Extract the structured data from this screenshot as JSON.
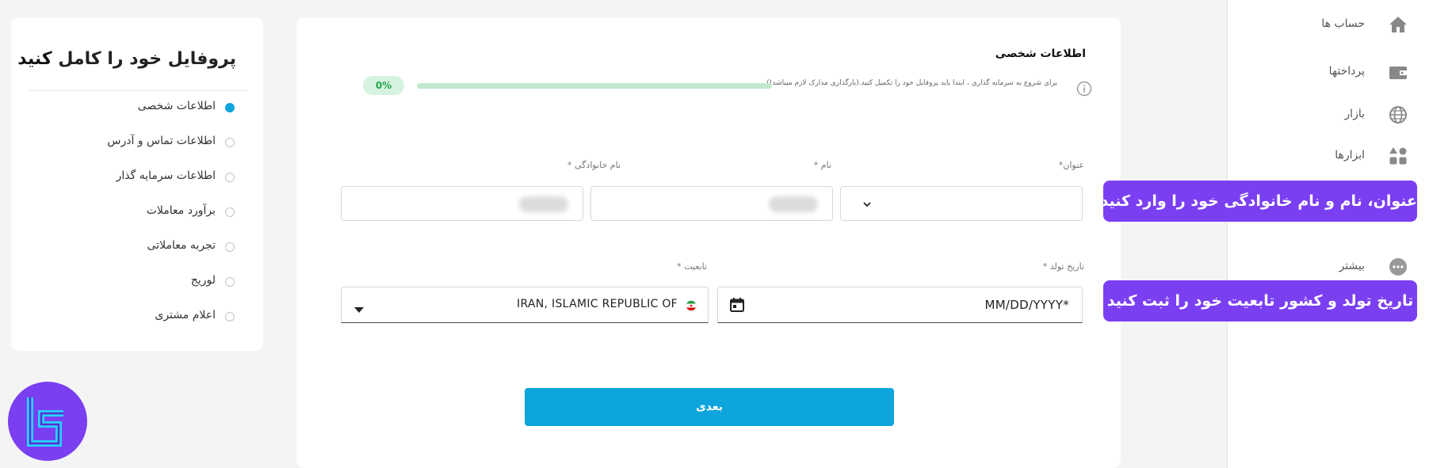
{
  "nav": {
    "items": [
      {
        "label": "حساب ها",
        "icon": "home-icon"
      },
      {
        "label": "پرداختها",
        "icon": "wallet-icon"
      },
      {
        "label": "بازار",
        "icon": "globe-icon"
      },
      {
        "label": "ابزارها",
        "icon": "grid-icon"
      },
      {
        "label": "بیشتر",
        "icon": "more-icon"
      }
    ]
  },
  "form": {
    "title": "اطلاعات شخصی",
    "notice": "برای شروع به سرمایه گذاری ، ابتدا باید پروفایل خود را تکمیل کنید.(بارگذاری مدارک لازم میباشد!)",
    "progress": {
      "percent": 0,
      "label": "0%"
    },
    "fields": {
      "title_label": "عنوان*",
      "first_name_label": "نام *",
      "last_name_label": "نام خانوادگی *",
      "birth_label": "تاریخ تولد *",
      "birth_value": "MM/DD/YYYY*",
      "nationality_label": "تابعیت *",
      "nationality_value": "IRAN, ISLAMIC REPUBLIC OF"
    },
    "next_label": "بعدی"
  },
  "steps": {
    "title_prefix": "پروفایل خود را کامل",
    "title_bold": "کنید",
    "items": [
      {
        "label": "اطلاعات شخصی",
        "active": true
      },
      {
        "label": "اطلاعات تماس و آدرس",
        "active": false
      },
      {
        "label": "اطلاعات سرمایه گذار",
        "active": false
      },
      {
        "label": "برآورد معاملات",
        "active": false
      },
      {
        "label": "تجربه معاملاتی",
        "active": false
      },
      {
        "label": "لوریج",
        "active": false
      },
      {
        "label": "اعلام مشتری",
        "active": false
      }
    ]
  },
  "tooltips": {
    "name_tip": "عنوان، نام و نام خانوادگی خود را وارد کنید",
    "birth_tip": "تاریخ تولد و کشور تابعیت خود را ثبت کنید"
  },
  "colors": {
    "accent": "#0ea5dd",
    "tooltip": "#7b3ff2",
    "progress": "#2fb45a",
    "logo": "#7a3ff0",
    "logo_mark": "#27d4ff"
  }
}
